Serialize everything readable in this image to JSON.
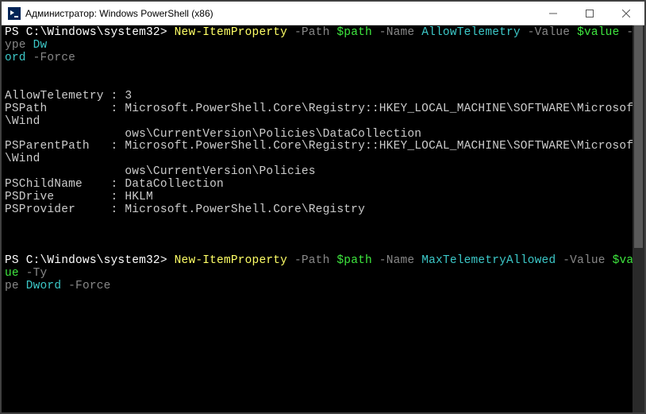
{
  "window": {
    "title": "Администратор: Windows PowerShell (x86)"
  },
  "terminal": {
    "prompt1_path": "PS C:\\Windows\\system32> ",
    "cmd1": {
      "cmdlet": "New-ItemProperty",
      "param_path": " -Path ",
      "var_path": "$path",
      "param_name": " -Name ",
      "name_value": "AllowTelemetry",
      "param_value": " -Value ",
      "var_value": "$value",
      "param_type": " -Type ",
      "type_value_line1": "Dw",
      "type_value_line2": "ord",
      "param_force": " -Force"
    },
    "output": {
      "allow_telemetry_label": "AllowTelemetry : ",
      "allow_telemetry_value": "3",
      "pspath_label": "PSPath         : ",
      "pspath_line1": "Microsoft.PowerShell.Core\\Registry::HKEY_LOCAL_MACHINE\\SOFTWARE\\Microsoft\\Wind",
      "pspath_line2": "                 ows\\CurrentVersion\\Policies\\DataCollection",
      "psparent_label": "PSParentPath   : ",
      "psparent_line1": "Microsoft.PowerShell.Core\\Registry::HKEY_LOCAL_MACHINE\\SOFTWARE\\Microsoft\\Wind",
      "psparent_line2": "                 ows\\CurrentVersion\\Policies",
      "pschild_label": "PSChildName    : ",
      "pschild_value": "DataCollection",
      "psdrive_label": "PSDrive        : ",
      "psdrive_value": "HKLM",
      "psprovider_label": "PSProvider     : ",
      "psprovider_value": "Microsoft.PowerShell.Core\\Registry"
    },
    "prompt2_path": "PS C:\\Windows\\system32> ",
    "cmd2": {
      "cmdlet": "New-ItemProperty",
      "param_path": " -Path ",
      "var_path": "$path",
      "param_name": " -Name ",
      "name_value": "MaxTelemetryAllowed",
      "param_value": " -Value ",
      "var_value": "$value",
      "param_type_line1": " -Ty",
      "param_type_line2": "pe ",
      "type_value": "Dword",
      "param_force": " -Force"
    }
  }
}
